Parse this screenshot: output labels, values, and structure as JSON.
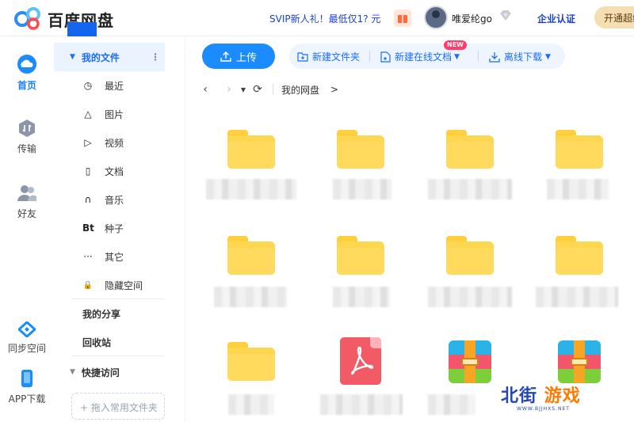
{
  "header": {
    "app_title": "百度网盘",
    "promo_text": "SVIP新人礼！最低仅1? 元",
    "username": "唯爱纶go",
    "enterprise_label": "企业认证",
    "open_vip_label": "开通超级会员"
  },
  "rail": {
    "home": "首页",
    "transfer": "传输",
    "friends": "好友",
    "sync": "同步空间",
    "app_download": "APP下载"
  },
  "sidebar": {
    "my_files": "我的文件",
    "items": [
      {
        "icon": "clock-icon",
        "glyph": "◷",
        "label": "最近"
      },
      {
        "icon": "image-icon",
        "glyph": "△",
        "label": "图片"
      },
      {
        "icon": "video-icon",
        "glyph": "▷",
        "label": "视频"
      },
      {
        "icon": "document-icon",
        "glyph": "▯",
        "label": "文档"
      },
      {
        "icon": "headphones-icon",
        "glyph": "∩",
        "label": "音乐"
      },
      {
        "icon": "torrent-icon",
        "glyph": "Bt",
        "label": "种子"
      },
      {
        "icon": "more-icon",
        "glyph": "···",
        "label": "其它"
      },
      {
        "icon": "lock-icon",
        "glyph": "🔒",
        "label": "隐藏空间"
      }
    ],
    "my_share": "我的分享",
    "recycle_bin": "回收站",
    "quick_access": "快捷访问",
    "drop_hint": "+ 拖入常用文件夹"
  },
  "toolbar": {
    "upload": "上传",
    "new_folder": "新建文件夹",
    "new_online_doc": "新建在线文档",
    "new_badge": "NEW",
    "offline_download": "离线下载"
  },
  "breadcrumb": {
    "root": "我的网盘",
    "separator": ">"
  },
  "files": [
    {
      "type": "folder"
    },
    {
      "type": "folder"
    },
    {
      "type": "folder"
    },
    {
      "type": "folder"
    },
    {
      "type": "folder"
    },
    {
      "type": "folder"
    },
    {
      "type": "folder"
    },
    {
      "type": "folder"
    },
    {
      "type": "folder"
    },
    {
      "type": "pdf"
    },
    {
      "type": "zip"
    },
    {
      "type": "zip"
    }
  ],
  "watermark": {
    "brand_left": "北街",
    "brand_right": "游戏",
    "url": "WWW.BJJHXS.NET"
  },
  "colors": {
    "accent": "#1a8cff",
    "brand_blue": "#1a3fd1",
    "folder_yellow": "#ffd64f",
    "selected_bg": "#eaf3ff"
  }
}
